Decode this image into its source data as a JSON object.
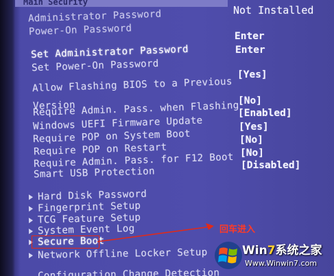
{
  "header": {
    "tab_label": "Main  Security"
  },
  "status_block": {
    "top_value": "Not Installed",
    "admin_password_label": "Administrator Password",
    "poweron_password_label": "Power-On Password"
  },
  "password_items": [
    {
      "label": "Set Administrator Password",
      "value": "Enter"
    },
    {
      "label": "Set Power-On Password",
      "value": "Enter"
    }
  ],
  "settings": [
    {
      "label": "Allow Flashing BIOS to a Previous",
      "value": "[Yes]"
    },
    {
      "label": "Version",
      "value": "[No]"
    },
    {
      "label": "Require Admin. Pass. when Flashing",
      "value": "[Enabled]"
    },
    {
      "label": "Windows UEFI Firmware Update",
      "value": "[Yes]"
    },
    {
      "label": "Require POP on System Boot",
      "value": "[No]"
    },
    {
      "label": "Require POP on Restart",
      "value": "[No]"
    },
    {
      "label": "Require Admin. Pass. for F12 Boot",
      "value": "[Disabled]"
    },
    {
      "label": "Smart USB Protection",
      "value": ""
    }
  ],
  "submenus": [
    {
      "label": "Hard Disk Password"
    },
    {
      "label": "Fingerprint Setup"
    },
    {
      "label": "TCG Feature Setup"
    },
    {
      "label": "System Event Log"
    },
    {
      "label": "Secure Boot"
    },
    {
      "label": "Network Offline Locker Setup"
    },
    {
      "label": "Configuration Change Detection"
    }
  ],
  "annotation": {
    "text": "回车进入",
    "color": "#ff3a26"
  },
  "watermark": {
    "brand_prefix": "Win",
    "brand_seven": "7",
    "brand_suffix": "系统之家",
    "url": "Www.Winwin7.com"
  },
  "colors": {
    "background": "#4f4dac",
    "text": "#dcdcf4",
    "highlight_border": "#e02a1a"
  }
}
